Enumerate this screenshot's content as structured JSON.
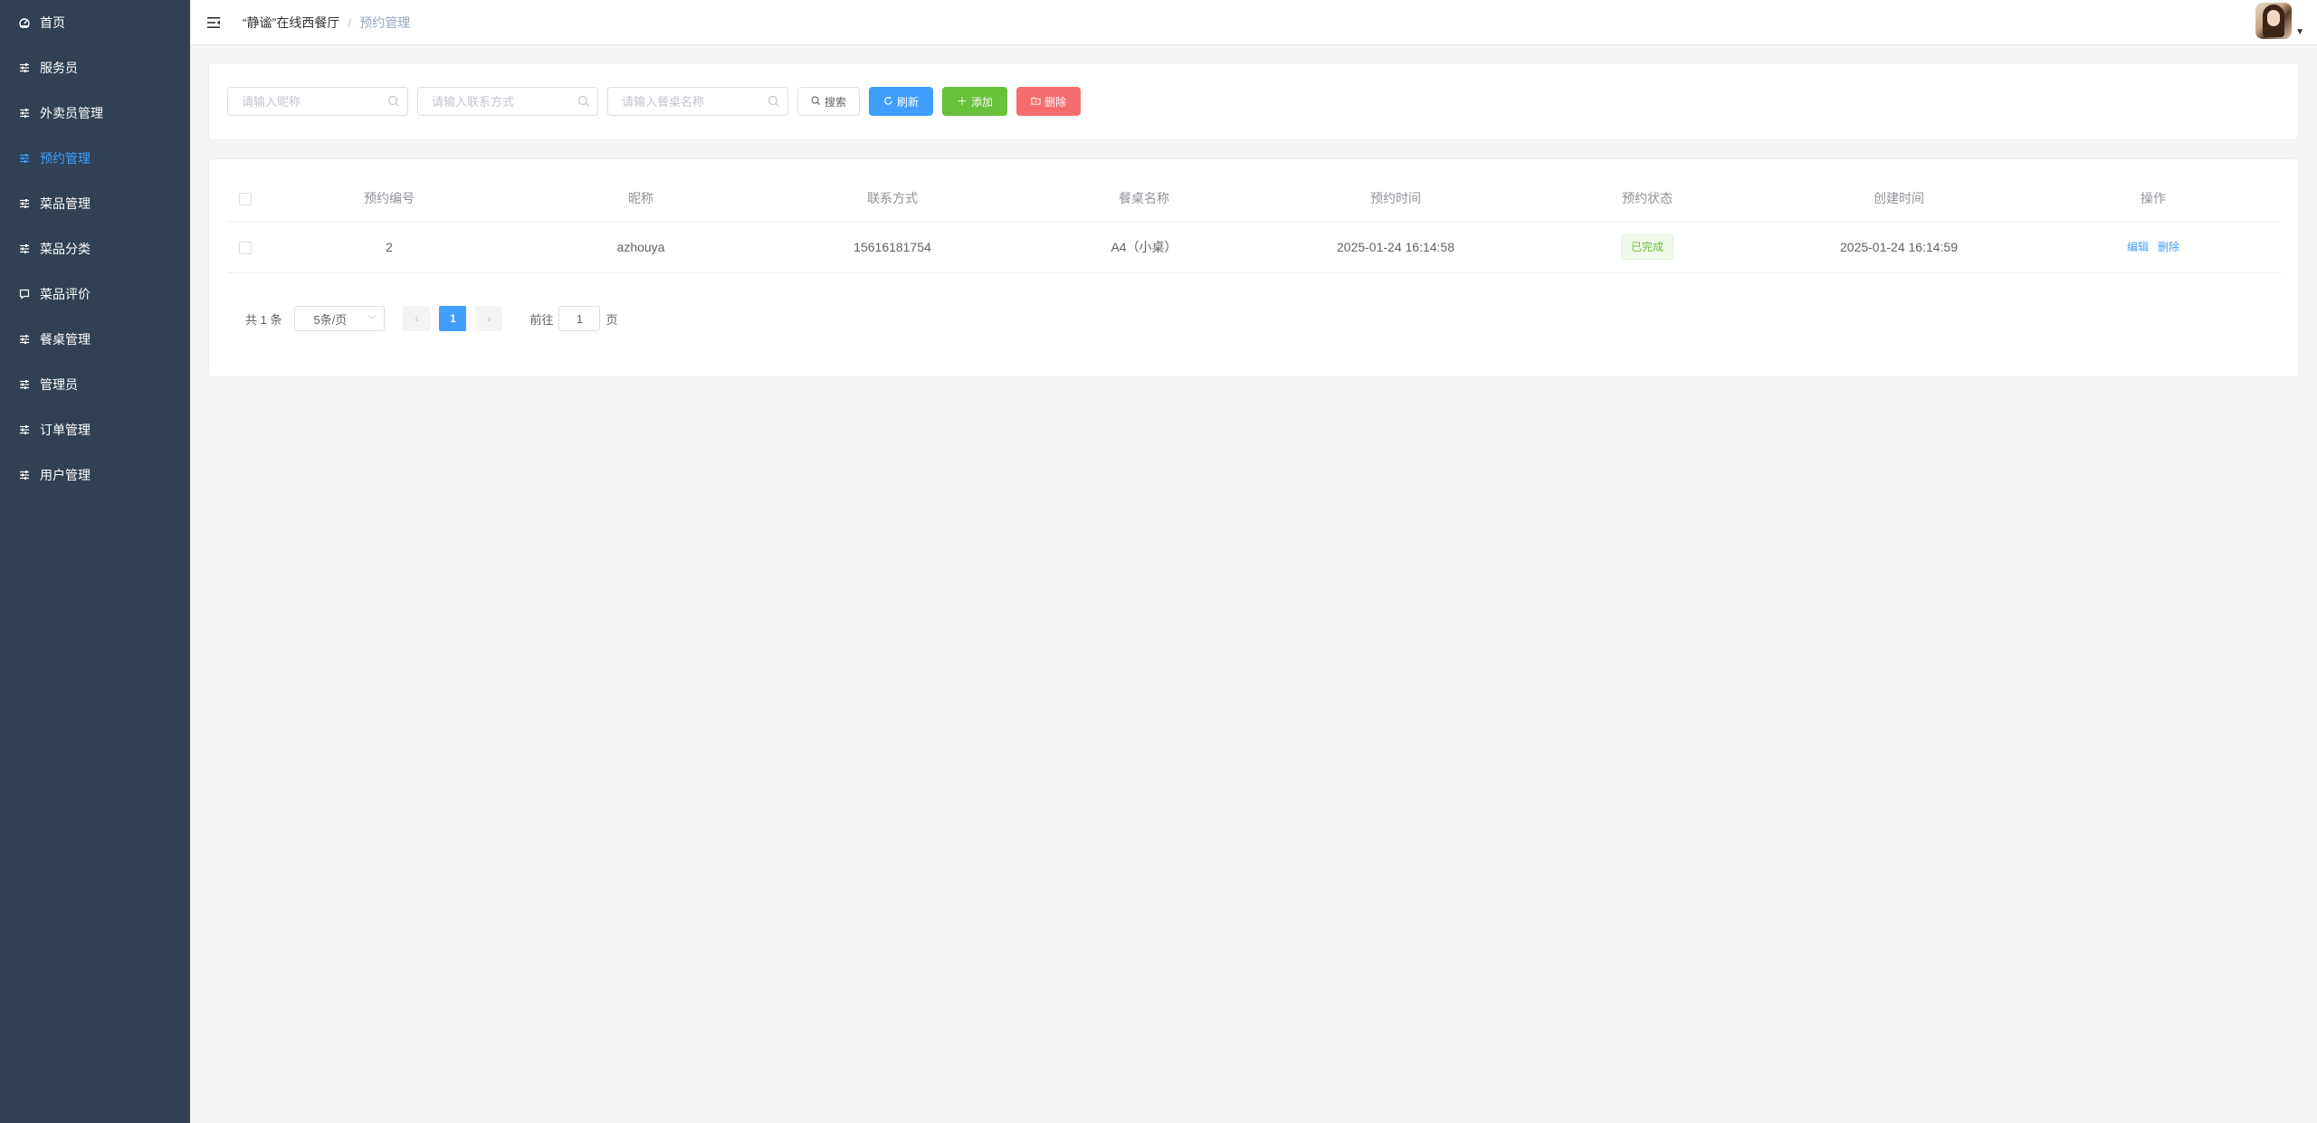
{
  "sidebar": {
    "items": [
      {
        "label": "首页",
        "icon": "dashboard-icon"
      },
      {
        "label": "服务员",
        "icon": "sliders-icon"
      },
      {
        "label": "外卖员管理",
        "icon": "sliders-icon"
      },
      {
        "label": "预约管理",
        "icon": "sliders-icon",
        "active": true
      },
      {
        "label": "菜品管理",
        "icon": "sliders-icon"
      },
      {
        "label": "菜品分类",
        "icon": "sliders-icon"
      },
      {
        "label": "菜品评价",
        "icon": "comment-icon"
      },
      {
        "label": "餐桌管理",
        "icon": "sliders-icon"
      },
      {
        "label": "管理员",
        "icon": "sliders-icon"
      },
      {
        "label": "订单管理",
        "icon": "sliders-icon"
      },
      {
        "label": "用户管理",
        "icon": "sliders-icon"
      }
    ],
    "active_color": "#409eff",
    "background": "#304156"
  },
  "header": {
    "breadcrumb_home": "“静谧”在线西餐厅",
    "breadcrumb_separator": "/",
    "breadcrumb_current": "预约管理"
  },
  "search": {
    "nickname_placeholder": "请输入昵称",
    "contact_placeholder": "请输入联系方式",
    "table_name_placeholder": "请输入餐桌名称",
    "search_label": "搜索",
    "refresh_label": "刷新",
    "add_label": "添加",
    "delete_label": "删除"
  },
  "table": {
    "columns": [
      "预约编号",
      "昵称",
      "联系方式",
      "餐桌名称",
      "预约时间",
      "预约状态",
      "创建时间",
      "操作"
    ],
    "rows": [
      {
        "id": "2",
        "nickname": "azhouya",
        "contact": "15616181754",
        "table_name": "A4（小桌）",
        "reserve_time": "2025-01-24 16:14:58",
        "status": "已完成",
        "created_time": "2025-01-24 16:14:59",
        "edit_label": "编辑",
        "delete_label": "删除"
      }
    ]
  },
  "pagination": {
    "total_text": "共 1 条",
    "page_size": "5条/页",
    "current_page": "1",
    "goto_prefix": "前往",
    "goto_value": "1",
    "goto_suffix": "页"
  },
  "colors": {
    "primary": "#409eff",
    "success": "#67c23a",
    "danger": "#f56c6c"
  }
}
